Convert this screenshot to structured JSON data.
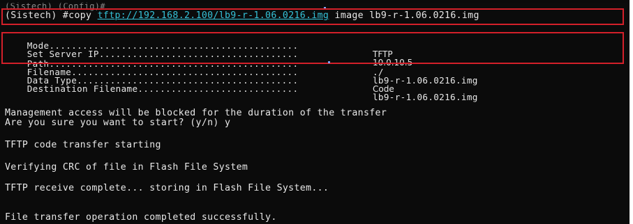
{
  "header": {
    "prev_prompt": "(Sistech) (Config)#",
    "command_prompt": "(Sistech) #copy ",
    "command_url": "tftp://192.168.2.100/lb9-r-1.06.0216.img",
    "command_tail": " image lb9-r-1.06.0216.img"
  },
  "properties": [
    {
      "label": "Mode.............................................",
      "value": "TFTP"
    },
    {
      "label": "Set Server IP....................................",
      "value": "10.0.10.5"
    },
    {
      "label": "Path.............................................",
      "value": "./"
    },
    {
      "label": "Filename.........................................",
      "value": "lb9-r-1.06.0216.img"
    },
    {
      "label": "Data Type........................................",
      "value": "Code"
    },
    {
      "label": "Destination Filename.............................",
      "value": "lb9-r-1.06.0216.img"
    }
  ],
  "messages": {
    "warning": "Management access will be blocked for the duration of the transfer",
    "confirm": "Are you sure you want to start? (y/n) y",
    "starting": "TFTP code transfer starting",
    "verifying": "Verifying CRC of file in Flash File System",
    "receive": "TFTP receive complete... storing in Flash File System...",
    "complete": "File transfer operation completed successfully."
  },
  "colors": {
    "background": "#0b0b0b",
    "text": "#e8e8e8",
    "link": "#35c2d8",
    "highlight_box": "#d4202a"
  }
}
